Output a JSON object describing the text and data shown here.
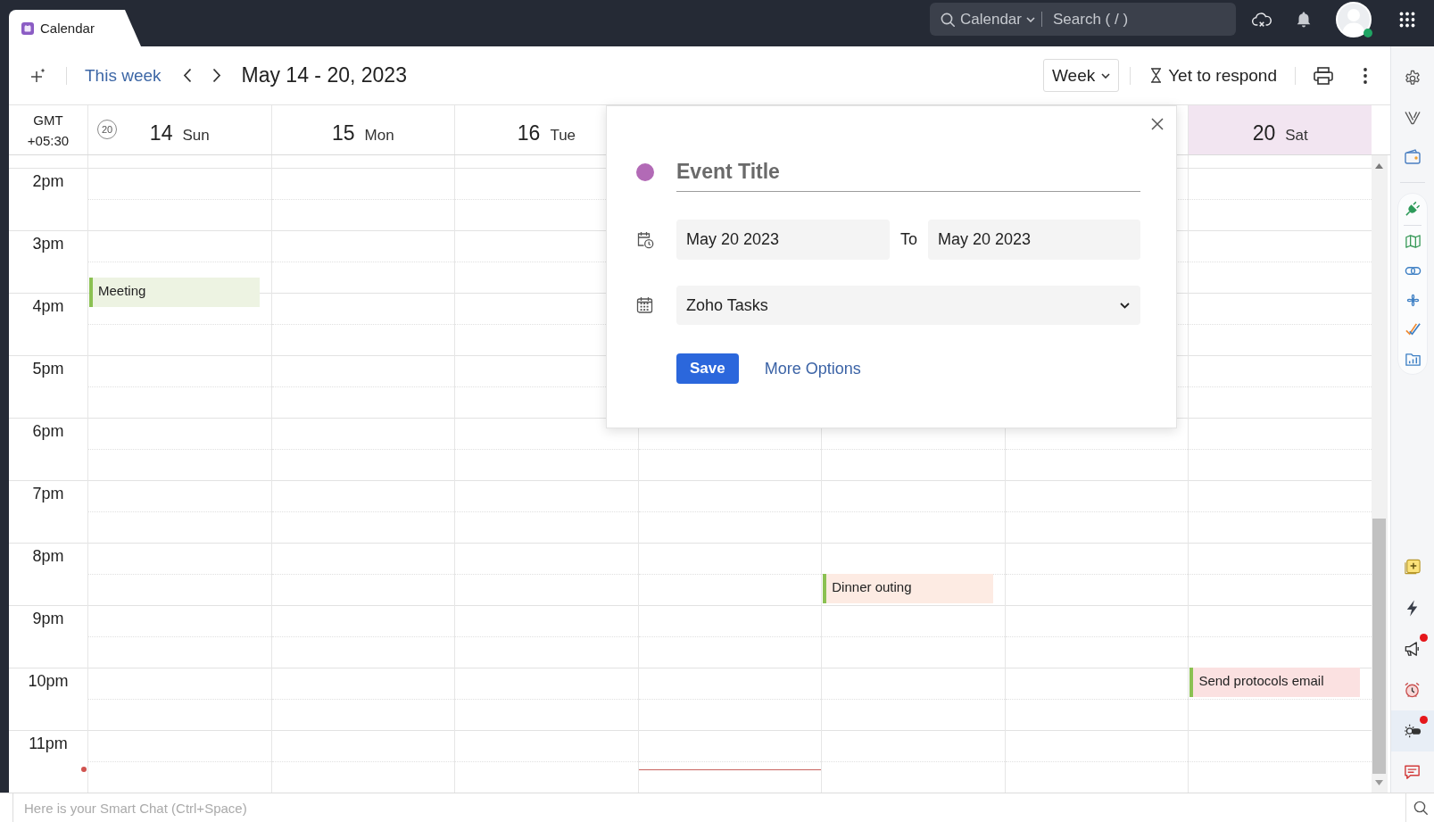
{
  "app_tab": {
    "label": "Calendar"
  },
  "search": {
    "scope": "Calendar",
    "placeholder": "Search ( / )"
  },
  "user": {
    "online": true
  },
  "toolbar": {
    "today_link": "This week",
    "date_range": "May 14 - 20, 2023",
    "view": "Week",
    "filter": "Yet to respond"
  },
  "timezone": {
    "name": "GMT",
    "offset": "+05:30"
  },
  "week_number": "20",
  "hours": [
    "2pm",
    "3pm",
    "4pm",
    "5pm",
    "6pm",
    "7pm",
    "8pm",
    "9pm",
    "10pm",
    "11pm"
  ],
  "days": [
    {
      "date": "14",
      "weekday": "Sun",
      "selected": false,
      "today": false,
      "events": [
        {
          "title": "Meeting",
          "color": "#edf3e2"
        }
      ]
    },
    {
      "date": "15",
      "weekday": "Mon",
      "selected": false,
      "today": false
    },
    {
      "date": "16",
      "weekday": "Tue",
      "selected": false,
      "today": false
    },
    {
      "today": true
    },
    {
      "today": false,
      "events": [
        {
          "title": "Dinner outing",
          "color": "#fdebe3"
        }
      ]
    },
    {
      "today": false
    },
    {
      "date": "20",
      "weekday": "Sat",
      "selected": true,
      "today": false,
      "events": [
        {
          "title": "Send protocols email",
          "color": "#fbe1e1"
        }
      ]
    }
  ],
  "quick_create": {
    "color": "#b26ab6",
    "title_placeholder": "Event Title",
    "start_date": "May 20 2023",
    "to_label": "To",
    "end_date": "May 20 2023",
    "calendar": "Zoho Tasks",
    "save": "Save",
    "more_options": "More Options"
  },
  "sidebar": {
    "tools": [
      {
        "kind": "note",
        "alert": false,
        "selected": false
      },
      {
        "kind": "bolt",
        "alert": false,
        "selected": false
      },
      {
        "kind": "megaphone",
        "alert": true,
        "selected": false
      },
      {
        "kind": "alarm",
        "alert": false,
        "selected": false
      },
      {
        "kind": "theme",
        "alert": true,
        "selected": true
      },
      {
        "kind": "chat",
        "alert": false,
        "selected": false
      }
    ]
  },
  "smart_chat": {
    "placeholder": "Here is your Smart Chat (Ctrl+Space)"
  }
}
